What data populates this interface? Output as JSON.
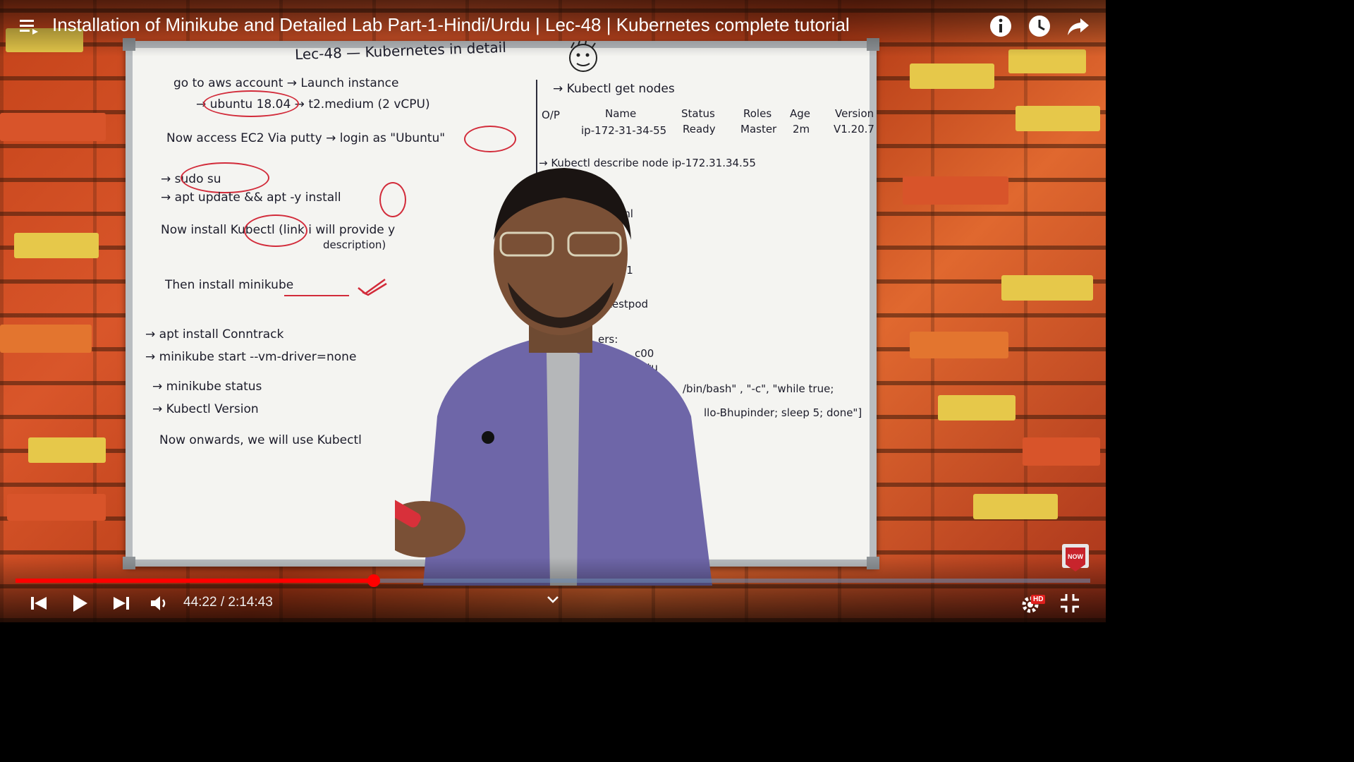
{
  "video": {
    "title": "Installation of Minikube and Detailed Lab Part-1-Hindi/Urdu | Lec-48 | Kubernetes complete tutorial",
    "current_time": "44:22",
    "duration": "2:14:43",
    "separator": "/",
    "progress": 0.3335,
    "quality_badge": "HD"
  },
  "subscribe_badge": "NOW",
  "colors": {
    "progress_played": "#ff0000",
    "progress_track": "#6e8cb4",
    "board": "#f4f4f1",
    "ink": "#1c1c2a",
    "marker_red": "#d22b3a"
  },
  "board": {
    "heading": "Lec-48 — Kubernetes in detail",
    "left": [
      "go to aws account → Launch instance",
      "→ ubuntu 18.04 → t2.medium (2 vCPU)",
      "Now access EC2 Via putty → login as \"Ubuntu\"",
      "→ sudo su",
      "→ apt update && apt -y install",
      "Now install Kubectl (link i will provide y",
      "description)",
      "Then install minikube",
      "→ apt install Conntrack",
      "→ minikube start --vm-driver=none",
      "→ minikube status",
      "→ Kubectl Version",
      "Now onwards, we will use Kubectl"
    ],
    "right_top": "→ Kubectl get nodes",
    "output_label": "O/P",
    "table_headers": [
      "Name",
      "Status",
      "Roles",
      "Age",
      "Version"
    ],
    "table_row": [
      "ip-172-31-34-55",
      "Ready",
      "Master",
      "2m",
      "V1.20.7"
    ],
    "describe": "→ Kubectl describe node ip-172.31.34.55",
    "fragments": [
      "1.yml",
      "V1",
      "testpod",
      "ers:",
      "c00",
      "ntu",
      "/bin/bash\" , \"-c\", \"while true;",
      "llo-Bhupinder; sleep 5; done\"]"
    ]
  },
  "icons": {
    "menu": "playlist-icon",
    "info": "info-icon",
    "watch_later": "clock-icon",
    "share": "share-icon",
    "prev": "previous-icon",
    "play": "play-icon",
    "next": "next-icon",
    "volume": "volume-icon",
    "chevron": "chevron-down-icon",
    "settings": "gear-icon",
    "exit_fullscreen": "exit-fullscreen-icon"
  }
}
